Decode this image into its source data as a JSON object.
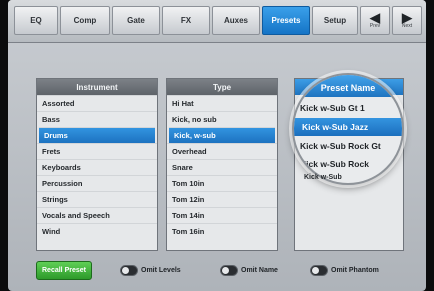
{
  "tabs": [
    {
      "label": "EQ"
    },
    {
      "label": "Comp"
    },
    {
      "label": "Gate"
    },
    {
      "label": "FX"
    },
    {
      "label": "Auxes"
    },
    {
      "label": "Presets",
      "active": true
    },
    {
      "label": "Setup"
    }
  ],
  "nav": {
    "prev_arrow": "◀",
    "prev_label": "Prev",
    "next_arrow": "▶",
    "next_label": "Next"
  },
  "instrument": {
    "header": "Instrument",
    "items": [
      "Assorted",
      "Bass",
      "Drums",
      "Frets",
      "Keyboards",
      "Percussion",
      "Strings",
      "Vocals and Speech",
      "Wind"
    ],
    "selected_index": 2
  },
  "type": {
    "header": "Type",
    "items": [
      "Hi Hat",
      "Kick, no sub",
      "Kick, w-sub",
      "Overhead",
      "Snare",
      "Tom 10in",
      "Tom 12in",
      "Tom 14in",
      "Tom 16in"
    ],
    "selected_index": 2
  },
  "preset_name": {
    "header": "Preset Name",
    "items": [
      "Kick w-Sub Gt 1",
      "Kick w-Sub Jazz",
      "Kick w-Sub Rock Gt",
      "Kick w-Sub Rock",
      "Kick w-Sub"
    ],
    "selected_index": 1
  },
  "controls": {
    "recall_label": "Recall Preset",
    "omit_levels": "Omit Levels",
    "omit_name": "Omit Name",
    "omit_phantom": "Omit Phantom"
  },
  "colors": {
    "accent": "#1f78c8",
    "recall": "#3aa236"
  }
}
